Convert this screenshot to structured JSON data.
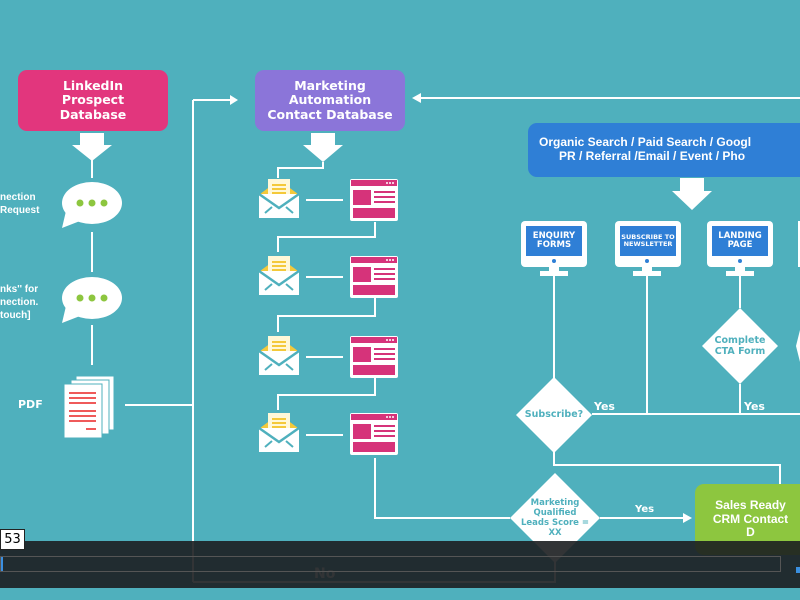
{
  "diagram": {
    "linkedin_box": "LinkedIn Prospect Database",
    "marketing_box": "Marketing Automation Contact Database",
    "sources_box_line1": "Organic Search / Paid Search / Googl",
    "sources_box_line2": "PR / Referral /Email / Event / Pho",
    "left_labels": {
      "connection_request": [
        "nection",
        "Request"
      ],
      "thanks": [
        "nks'' for",
        "nection.",
        "touch]"
      ],
      "pdf": "PDF"
    },
    "monitors": [
      "ENQUIRY FORMS",
      "SUBSCRIBE TO NEWSLETTER",
      "LANDING PAGE"
    ],
    "decisions": {
      "subscribe": "Subscribe?",
      "cta": "Complete CTA Form",
      "mql": "Marketing Qualified Leads Score = XX"
    },
    "yes_labels": [
      "Yes",
      "Yes",
      "Yes"
    ],
    "no_label": "No",
    "sales_box": "Sales Ready CRM Contact D",
    "colors": {
      "background": "#4fb0bd",
      "pink": "#e2367d",
      "purple": "#8b75d9",
      "blue": "#2f7fd6",
      "green": "#8dc63f",
      "yellow": "#f4c93a"
    }
  },
  "player": {
    "time_tooltip": "53"
  }
}
